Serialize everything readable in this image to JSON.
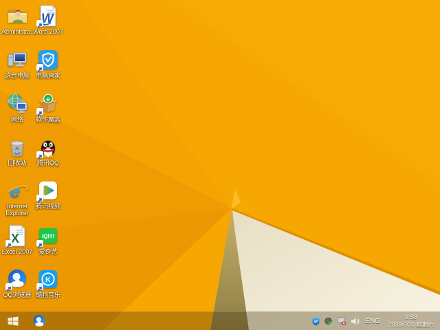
{
  "desktop": {
    "icons": [
      {
        "name": "user-folder",
        "label": "Administra..."
      },
      {
        "name": "word-2007",
        "label": "Word 2007"
      },
      {
        "name": "this-pc",
        "label": "这台电脑"
      },
      {
        "name": "pc-manager",
        "label": "电脑管家"
      },
      {
        "name": "network",
        "label": "网络"
      },
      {
        "name": "software-box",
        "label": "软件魔盒"
      },
      {
        "name": "recycle-bin",
        "label": "回收站"
      },
      {
        "name": "tencent-qq",
        "label": "腾讯QQ"
      },
      {
        "name": "internet-explorer",
        "label": "Internet Explorer"
      },
      {
        "name": "tencent-video",
        "label": "腾讯视频"
      },
      {
        "name": "excel-2007",
        "label": "Excel 2007"
      },
      {
        "name": "iqiyi",
        "label": "爱奇艺"
      },
      {
        "name": "qq-browser",
        "label": "QQ浏览器"
      },
      {
        "name": "kugou-music",
        "label": "酷狗音乐"
      }
    ]
  },
  "icon_glyphs": {
    "word": "W",
    "excel": "X",
    "ie": "e",
    "software_box": "e",
    "iqiyi": "iQIYI",
    "kugou": "K"
  },
  "taskbar": {
    "pinned": [
      "qq-browser"
    ],
    "tray_icons": [
      "pc-manager-tray",
      "security-check-tray",
      "network-disconnected-tray",
      "volume-tray"
    ],
    "language_indicator": "ENG",
    "clock": {
      "time": "9:58",
      "date": "2018/6/30 星期六"
    }
  },
  "colors": {
    "wallpaper_orange": "#F7A701",
    "wallpaper_facet_dark": "#EF9C03",
    "white_triangle": "#F2ECDA",
    "olive_triangle": "#A8974F",
    "edge_shadow": "#DD8F00",
    "pc_manager_blue": "#2B9CE8",
    "iqiyi_green": "#1CC749",
    "kugou_blue": "#119FF2",
    "qq_scarf_red": "#E03030"
  }
}
